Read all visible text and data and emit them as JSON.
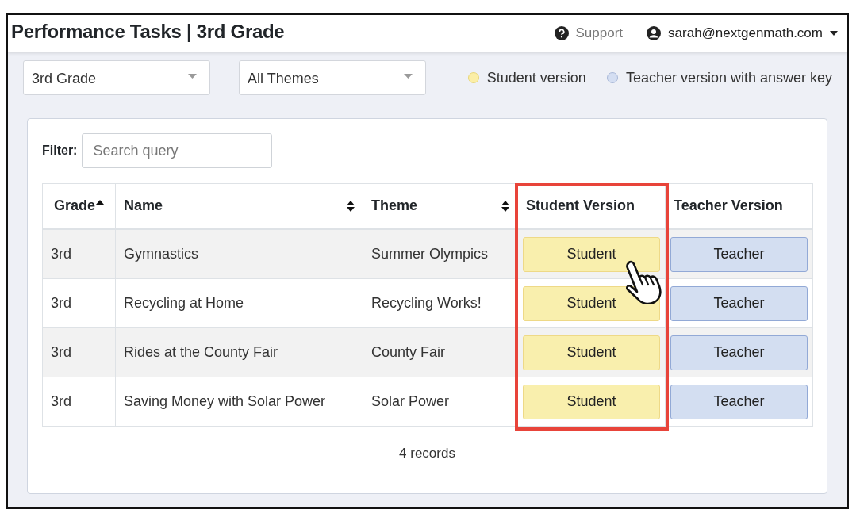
{
  "header": {
    "title": "Performance Tasks | 3rd Grade",
    "support": "Support",
    "user": "sarah@nextgenmath.com"
  },
  "filters": {
    "grade": "3rd Grade",
    "theme": "All Themes"
  },
  "legend": [
    {
      "label": "Student version",
      "color": "#fbeea6"
    },
    {
      "label": "Teacher version with answer key",
      "color": "#d4def2"
    }
  ],
  "table_filter": {
    "label": "Filter:",
    "placeholder": "Search query"
  },
  "table": {
    "columns": [
      {
        "label": "Grade",
        "kind": "sorted",
        "highlighted": false
      },
      {
        "label": "Name",
        "kind": "sortable",
        "highlighted": false
      },
      {
        "label": "Theme",
        "kind": "sortable",
        "highlighted": false
      },
      {
        "label": "Student Version",
        "kind": "plain",
        "highlighted": true
      },
      {
        "label": "Teacher Version",
        "kind": "plain",
        "highlighted": false
      }
    ],
    "rows": [
      {
        "grade": "3rd",
        "name": "Gymnastics",
        "theme": "Summer Olympics",
        "student": "Student",
        "teacher": "Teacher"
      },
      {
        "grade": "3rd",
        "name": "Recycling at Home",
        "theme": "Recycling Works!",
        "student": "Student",
        "teacher": "Teacher"
      },
      {
        "grade": "3rd",
        "name": "Rides at the County Fair",
        "theme": "County Fair",
        "student": "Student",
        "teacher": "Teacher"
      },
      {
        "grade": "3rd",
        "name": "Saving Money with Solar Power",
        "theme": "Solar Power",
        "student": "Student",
        "teacher": "Teacher"
      }
    ],
    "records": "4 records"
  }
}
